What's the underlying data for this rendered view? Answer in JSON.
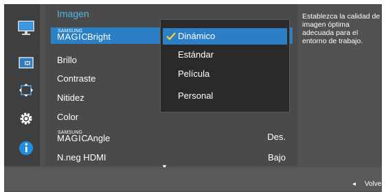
{
  "menu": {
    "title": "Imagen",
    "rows": [
      {
        "label": "Brillo"
      },
      {
        "label": "Contraste"
      },
      {
        "label": "Nitidez"
      },
      {
        "label": "Color"
      },
      {
        "label": "N.neg HDMI",
        "value": "Bajo"
      }
    ],
    "magic_bright": {
      "samsung": "SAMSUNG",
      "magic": "MAGIC",
      "suffix": "Bright"
    },
    "magic_angle": {
      "samsung": "SAMSUNG",
      "magic": "MAGIC",
      "suffix": "Angle",
      "value": "Des."
    }
  },
  "submenu": {
    "items": [
      "Dinámico",
      "Estándar",
      "Película",
      "Personal"
    ],
    "selected_index": 0
  },
  "help_text": "Establezca la calidad de imagen óptima adecuada para el entorno de trabajo.",
  "footer": {
    "back_label": "Volver"
  },
  "sidebar_icons": [
    "monitor-icon",
    "picture-icon",
    "move-icon",
    "gear-icon",
    "info-icon"
  ],
  "colors": {
    "accent": "#2b7fc5",
    "title": "#4fb7ea",
    "panel": "#4a4a4a",
    "submenu": "#2a2a2a"
  }
}
